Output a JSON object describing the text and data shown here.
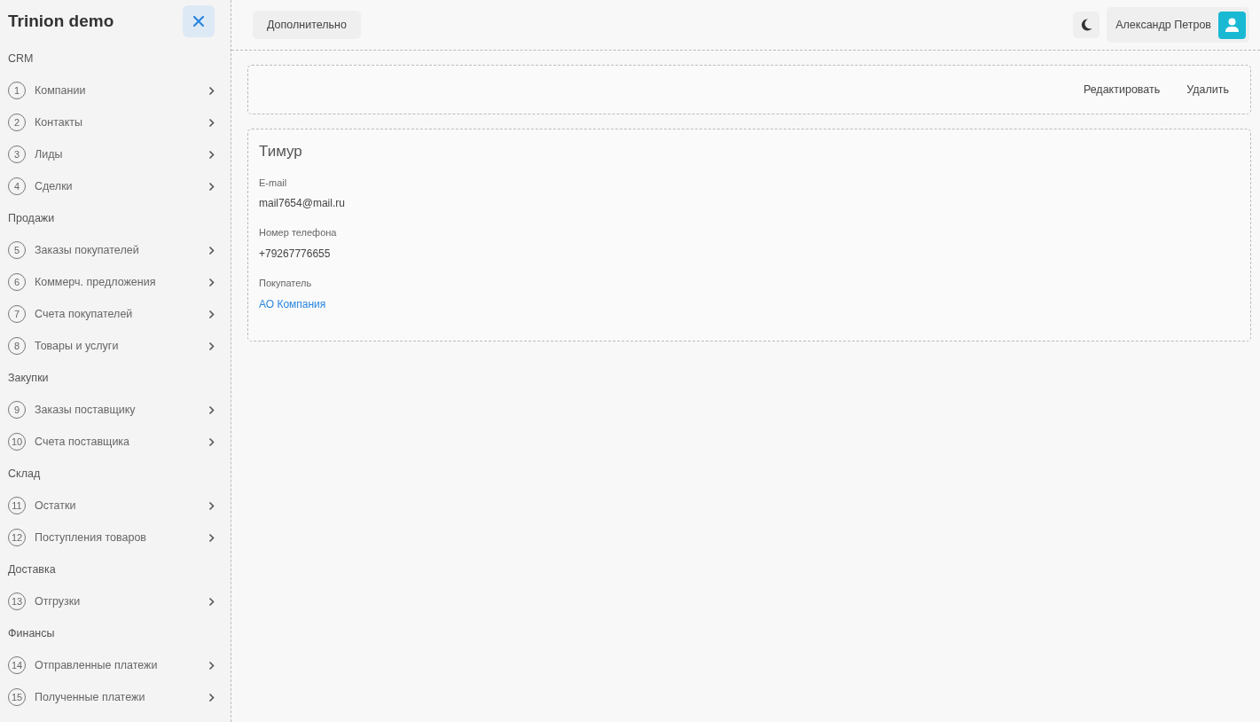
{
  "sidebar": {
    "title": "Trinion demo",
    "sections": [
      {
        "label": "CRM",
        "items": [
          {
            "number": "1",
            "label": "Компании"
          },
          {
            "number": "2",
            "label": "Контакты"
          },
          {
            "number": "3",
            "label": "Лиды"
          },
          {
            "number": "4",
            "label": "Сделки"
          }
        ]
      },
      {
        "label": "Продажи",
        "items": [
          {
            "number": "5",
            "label": "Заказы покупателей"
          },
          {
            "number": "6",
            "label": "Коммерч. предложения"
          },
          {
            "number": "7",
            "label": "Счета покупателей"
          },
          {
            "number": "8",
            "label": "Товары и услуги"
          }
        ]
      },
      {
        "label": "Закупки",
        "items": [
          {
            "number": "9",
            "label": "Заказы поставщику"
          },
          {
            "number": "10",
            "label": "Счета поставщика"
          }
        ]
      },
      {
        "label": "Склад",
        "items": [
          {
            "number": "11",
            "label": "Остатки"
          },
          {
            "number": "12",
            "label": "Поступления товаров"
          }
        ]
      },
      {
        "label": "Доставка",
        "items": [
          {
            "number": "13",
            "label": "Отгрузки"
          }
        ]
      },
      {
        "label": "Финансы",
        "items": [
          {
            "number": "14",
            "label": "Отправленные платежи"
          },
          {
            "number": "15",
            "label": "Полученные платежи"
          }
        ]
      }
    ]
  },
  "header": {
    "more_button": "Дополнительно",
    "user_name": "Александр Петров"
  },
  "toolbar": {
    "actions": [
      "Редактировать",
      "Удалить"
    ]
  },
  "record": {
    "title": "Тимур",
    "fields": [
      {
        "label": "E-mail",
        "value": "mail7654@mail.ru",
        "kind": "text"
      },
      {
        "label": "Номер телефона",
        "value": "+79267776655",
        "kind": "text"
      },
      {
        "label": "Покупатель",
        "value": "АО Компания",
        "kind": "link"
      }
    ]
  }
}
